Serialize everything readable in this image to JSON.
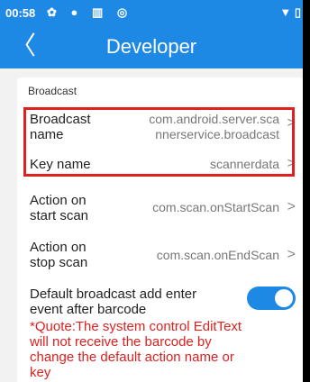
{
  "status": {
    "time": "00:58",
    "left_icons": "✿ ● ▥ ◎",
    "right_icons": "▼ ▯"
  },
  "appbar": {
    "back_glyph": "〈",
    "title": "Developer"
  },
  "section_title": "Broadcast",
  "rows": [
    {
      "label_lines": [
        "Broadcast",
        "name"
      ],
      "value_lines": [
        "com.android.server.sca",
        "nnerservice.broadcast"
      ]
    },
    {
      "label_lines": [
        "Key name"
      ],
      "value_lines": [
        "scannerdata"
      ]
    },
    {
      "label_lines": [
        "Action on",
        "start scan"
      ],
      "value_lines": [
        "com.scan.onStartScan"
      ]
    },
    {
      "label_lines": [
        "Action on",
        "stop scan"
      ],
      "value_lines": [
        "com.scan.onEndScan"
      ]
    }
  ],
  "chevron": ">",
  "toggle": {
    "label_lines": [
      "Default broadcast add enter",
      "event after barcode"
    ],
    "on": true
  },
  "note_lines": [
    "*Quote:The system control EditText",
    "will not receive the barcode by",
    "change the default action name or",
    "key"
  ],
  "colors": {
    "primary": "#1e88e5",
    "highlight": "#e0201f",
    "warning": "#e0201f"
  }
}
